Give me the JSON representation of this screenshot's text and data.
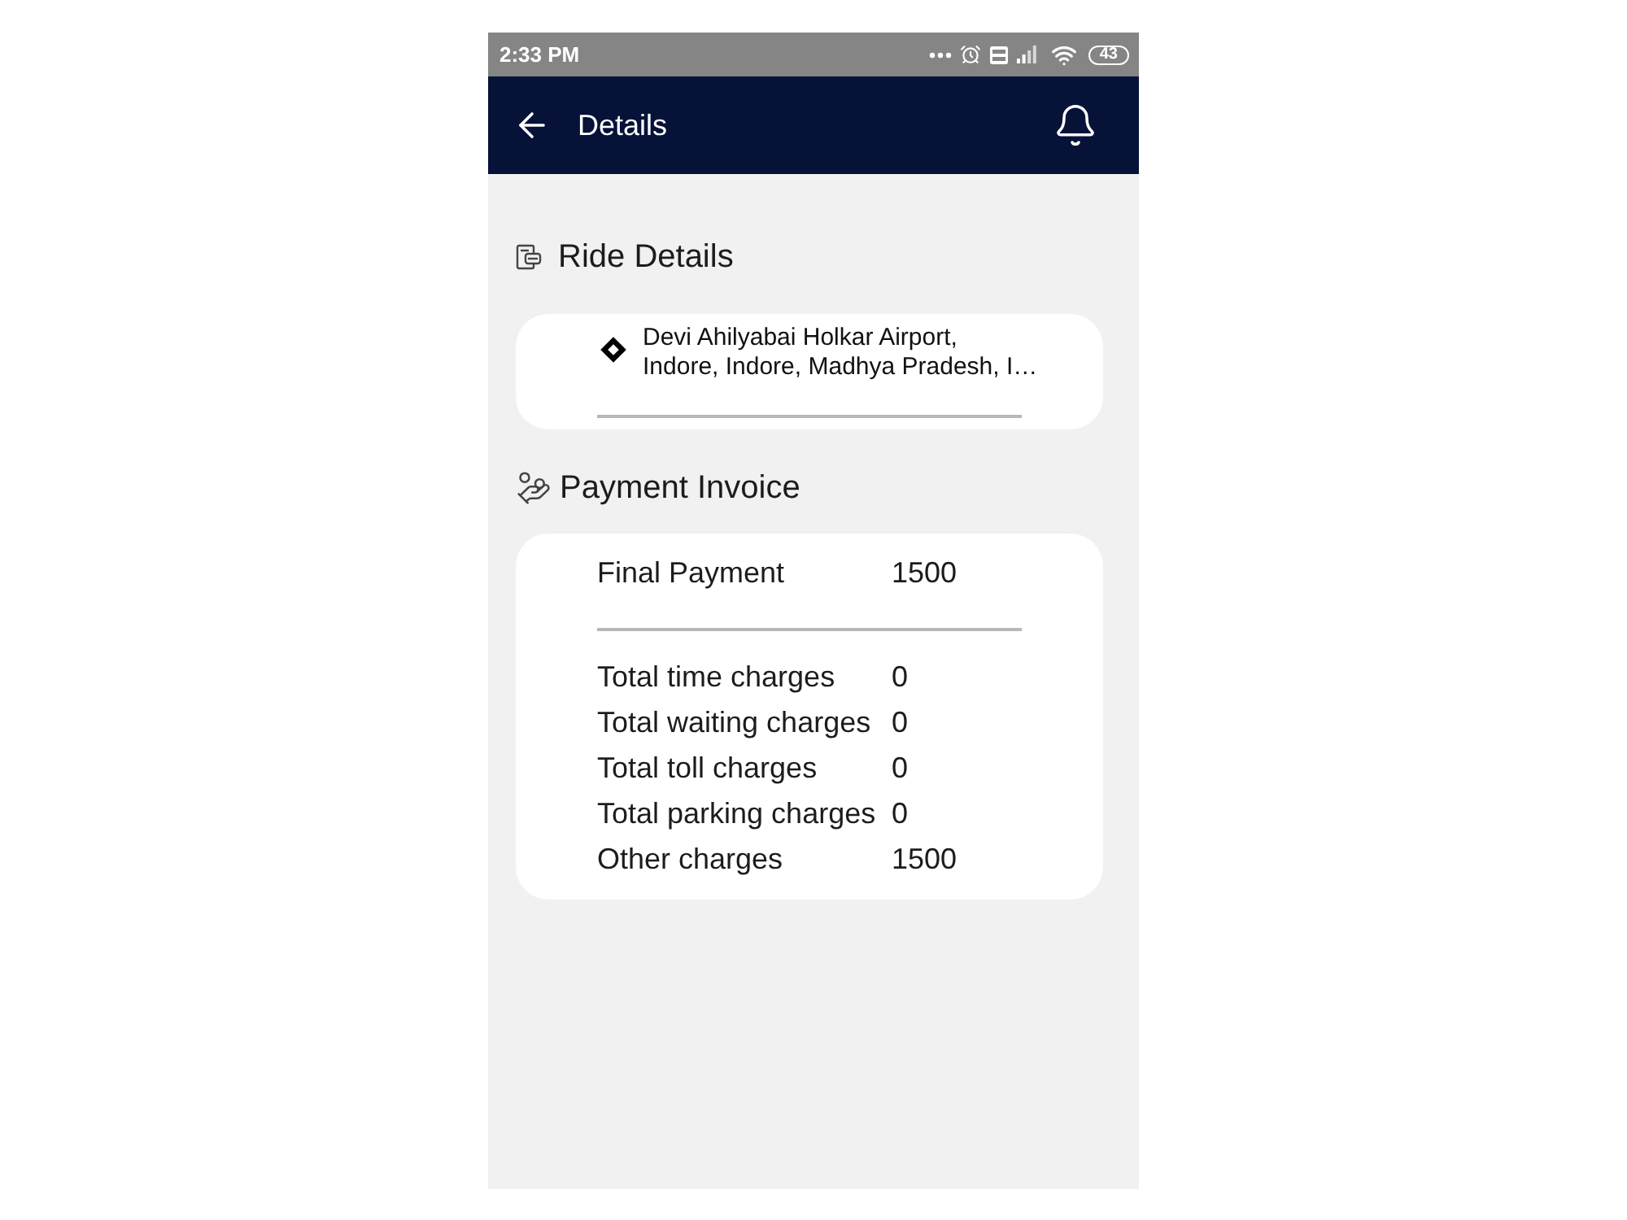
{
  "status_bar": {
    "time": "2:33 PM",
    "battery": "43"
  },
  "header": {
    "title": "Details"
  },
  "ride_details": {
    "title": "Ride Details",
    "address": "Devi Ahilyabai Holkar Airport, Indore, Indore, Madhya Pradesh, I…"
  },
  "payment_invoice": {
    "title": "Payment Invoice",
    "final_payment": {
      "label": "Final Payment",
      "value": "1500"
    },
    "charges": [
      {
        "label": "Total time charges",
        "value": "0"
      },
      {
        "label": "Total waiting charges",
        "value": "0"
      },
      {
        "label": "Total toll charges",
        "value": "0"
      },
      {
        "label": "Total parking charges",
        "value": "0"
      },
      {
        "label": "Other charges",
        "value": "1500"
      }
    ]
  }
}
